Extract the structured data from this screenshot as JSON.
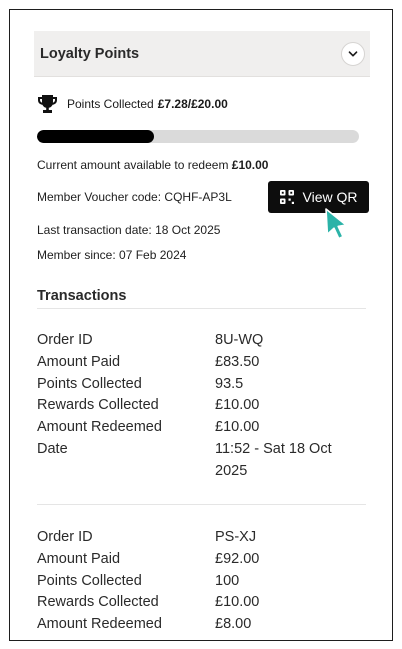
{
  "loyalty": {
    "title": "Loyalty Points",
    "points_label": "Points Collected",
    "points_value": "£7.28/£20.00",
    "progress_fraction": 0.364,
    "redeem_label": "Current amount available to redeem",
    "redeem_value": "£10.00",
    "voucher_line": "Member Voucher code: CQHF-AP3L",
    "view_qr_label": "View QR",
    "last_transaction": "Last transaction date: 18 Oct 2025",
    "member_since": "Member since: 07 Feb 2024"
  },
  "transactions": {
    "title": "Transactions",
    "items": [
      {
        "rows": [
          {
            "key": "Order ID",
            "value": "8U-WQ"
          },
          {
            "key": "Amount Paid",
            "value": "£83.50"
          },
          {
            "key": "Points Collected",
            "value": "93.5"
          },
          {
            "key": "Rewards Collected",
            "value": "£10.00"
          },
          {
            "key": "Amount Redeemed",
            "value": "£10.00"
          },
          {
            "key": "Date",
            "value": "11:52 - Sat 18 Oct 2025"
          }
        ]
      },
      {
        "rows": [
          {
            "key": "Order ID",
            "value": "PS-XJ"
          },
          {
            "key": "Amount Paid",
            "value": "£92.00"
          },
          {
            "key": "Points Collected",
            "value": "100"
          },
          {
            "key": "Rewards Collected",
            "value": "£10.00"
          },
          {
            "key": "Amount Redeemed",
            "value": "£8.00"
          }
        ]
      }
    ]
  },
  "icons": {
    "trophy": "trophy-icon",
    "chevron": "chevron-down-icon",
    "qr": "qr-code-icon",
    "cursor": "mouse-pointer-icon"
  },
  "colors": {
    "header_bg": "#f0efee",
    "progress_fill": "#000000",
    "progress_track": "#dadada",
    "button_bg": "#0d0d0d",
    "cursor": "#2bb3a8"
  }
}
